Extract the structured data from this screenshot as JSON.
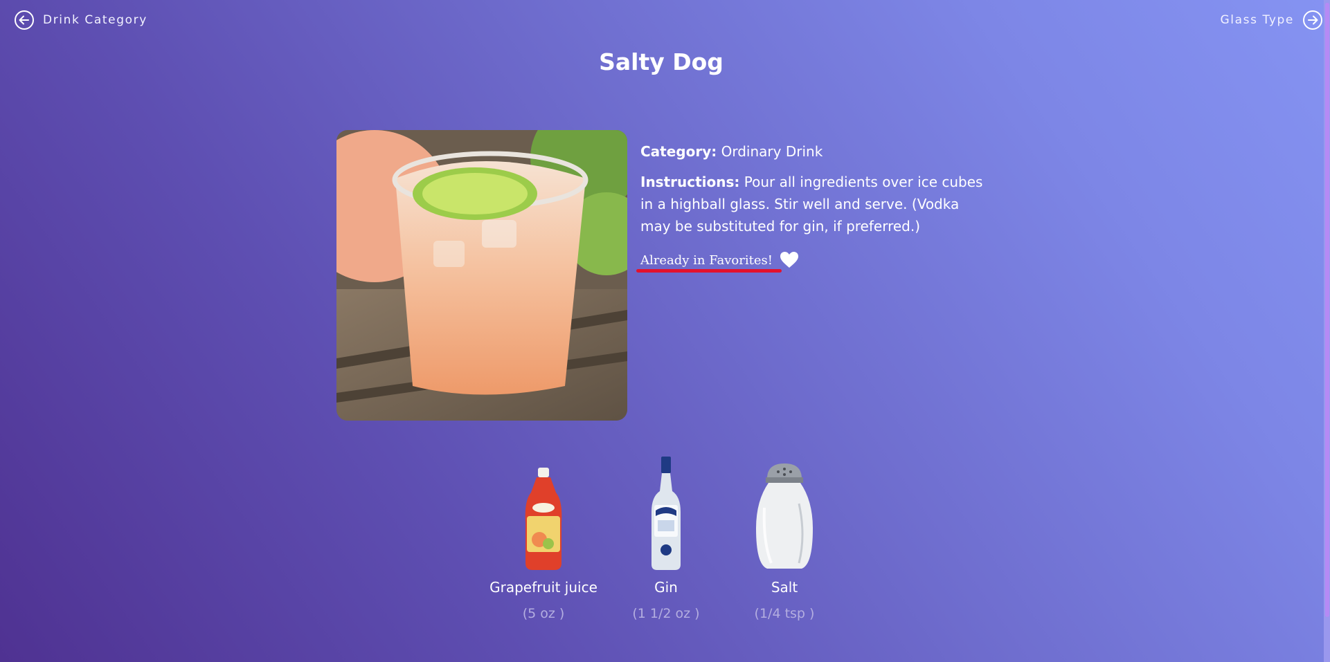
{
  "nav": {
    "back_label": "Drink Category",
    "forward_label": "Glass Type",
    "back_icon": "arrow-left-circle-icon",
    "forward_icon": "arrow-right-circle-icon"
  },
  "drink": {
    "title": "Salty Dog",
    "photo_icon": "drink-photo",
    "category_label": "Category:",
    "category_value": "Ordinary Drink",
    "instructions_label": "Instructions:",
    "instructions_value": "Pour all ingredients over ice cubes in a highball glass. Stir well and serve. (Vodka may be substituted for gin, if preferred.)",
    "favorite_text": "Already in Favorites!",
    "favorite_icon": "heart-icon"
  },
  "ingredients": [
    {
      "name": "Grapefruit juice",
      "measure": "(5 oz )",
      "icon": "grapefruit-juice-bottle"
    },
    {
      "name": "Gin",
      "measure": "(1 1/2 oz )",
      "icon": "gin-bottle"
    },
    {
      "name": "Salt",
      "measure": "(1/4 tsp )",
      "icon": "salt-shaker"
    }
  ],
  "colors": {
    "background_start": "#4f3292",
    "background_end": "#8593f2",
    "favorite_underline": "#e3112d",
    "measure_text": "#b4aee0"
  }
}
